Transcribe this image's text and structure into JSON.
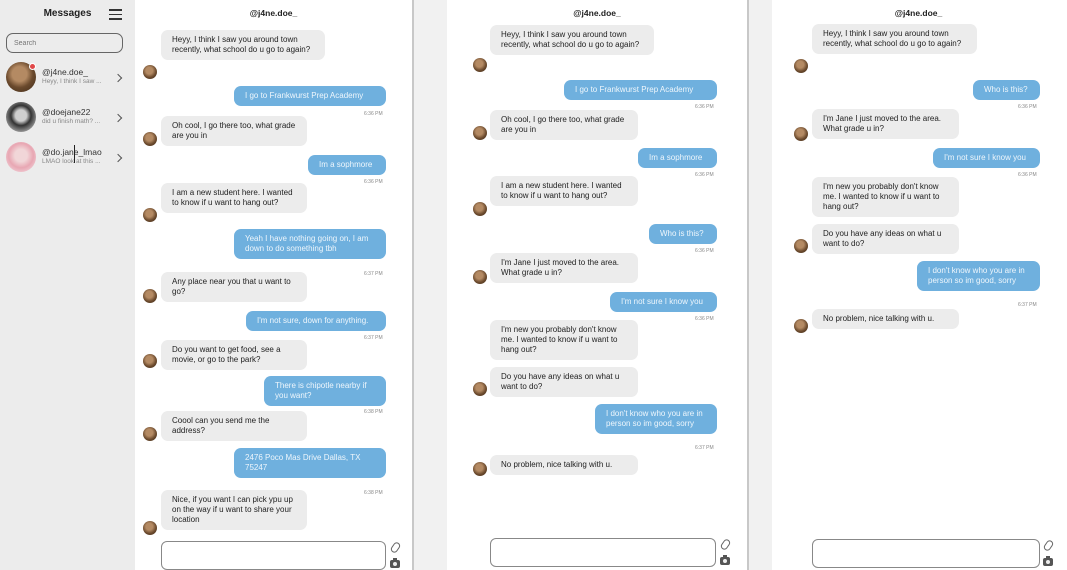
{
  "sidebar": {
    "title": "Messages",
    "search_placeholder": "Search",
    "conversations": [
      {
        "name": "@j4ne.doe_",
        "preview": "Heyy, I think I saw ..."
      },
      {
        "name": "@doejane22",
        "preview": "did u finish math? ..."
      },
      {
        "name": "@do.jane_lmao",
        "preview": "LMAO look at this ..."
      }
    ]
  },
  "panel1": {
    "header": "@j4ne.doe_",
    "messages": [
      {
        "dir": "in",
        "text": "Heyy, I think I saw you around town recently, what school do u go to again?"
      },
      {
        "dir": "out",
        "text": "I go to Frankwurst Prep Academy",
        "time": "6:36 PM"
      },
      {
        "dir": "in",
        "text": "Oh cool, I go there too, what grade are you in"
      },
      {
        "dir": "out",
        "text": "Im a sophmore",
        "time": "6:36 PM"
      },
      {
        "dir": "in",
        "text": "I am a new student here. I wanted to know if u want to hang out?"
      },
      {
        "dir": "out",
        "text": "Yeah I have nothing going on, I am down to do something tbh",
        "time": "6:37 PM"
      },
      {
        "dir": "in",
        "text": "Any place near you that u want to go?"
      },
      {
        "dir": "out",
        "text": "I'm not sure, down for anything.",
        "time": "6:37 PM"
      },
      {
        "dir": "in",
        "text": "Do you want to get food, see a movie, or go to the park?"
      },
      {
        "dir": "out",
        "text": "There is chipotle nearby if you want?",
        "time": "6:38 PM"
      },
      {
        "dir": "in",
        "text": "Coool can you send me the address?"
      },
      {
        "dir": "out",
        "text": "2476 Poco Mas Drive Dallas, TX 75247",
        "time": "6:38 PM"
      },
      {
        "dir": "in",
        "text": "Nice, if you want I can pick ypu up on the way if u want to share your location"
      }
    ]
  },
  "panel2": {
    "header": "@j4ne.doe_",
    "messages": [
      {
        "dir": "in",
        "text": "Heyy, I think I saw you around town recently, what school do u go to again?"
      },
      {
        "dir": "out",
        "text": "I go to Frankwurst Prep Academy",
        "time": "6:36 PM"
      },
      {
        "dir": "in",
        "text": "Oh cool, I go there too, what grade are you in"
      },
      {
        "dir": "out",
        "text": "Im a sophmore",
        "time": "6:36 PM"
      },
      {
        "dir": "in",
        "text": "I am a new student here. I wanted to know if u want to hang out?"
      },
      {
        "dir": "out",
        "text": "Who is this?",
        "time": "6:36 PM"
      },
      {
        "dir": "in",
        "text": "I'm Jane I just moved to the area. What grade u in?"
      },
      {
        "dir": "out",
        "text": "I'm not sure I know you",
        "time": "6:36 PM"
      },
      {
        "dir": "in",
        "text": "I'm new you probably don't know me. I wanted to know if u want to hang out?"
      },
      {
        "dir": "in",
        "text": "Do you have any ideas on what u want to do?"
      },
      {
        "dir": "out",
        "text": "I don't know who you are in person so im good, sorry",
        "time": "6:37 PM"
      },
      {
        "dir": "in",
        "text": "No problem, nice talking with u."
      }
    ]
  },
  "panel3": {
    "header": "@j4ne.doe_",
    "messages": [
      {
        "dir": "in",
        "text": "Heyy, I think I saw you around town recently, what school do u go to again?"
      },
      {
        "dir": "out",
        "text": "Who is this?",
        "time": "6:36 PM"
      },
      {
        "dir": "in",
        "text": "I'm Jane I just moved to the area. What grade u in?"
      },
      {
        "dir": "out",
        "text": "I'm not sure I know you",
        "time": "6:36 PM"
      },
      {
        "dir": "in",
        "text": "I'm new you probably don't know me. I wanted to know if u want to hang out?"
      },
      {
        "dir": "in",
        "text": "Do you have any ideas on what u want to do?"
      },
      {
        "dir": "out",
        "text": "I don't know who you are in person so im good, sorry",
        "time": "6:37 PM"
      },
      {
        "dir": "in",
        "text": "No problem, nice talking with u."
      }
    ]
  },
  "icons": {
    "menu": "hamburger-icon",
    "chevron": "chevron-right-icon",
    "attach": "paperclip-icon",
    "camera": "camera-icon"
  },
  "colors": {
    "outgoing_bubble": "#6fb0de",
    "incoming_bubble": "#ececec",
    "sidebar_bg": "#ececec",
    "unread_badge": "#e04848"
  }
}
